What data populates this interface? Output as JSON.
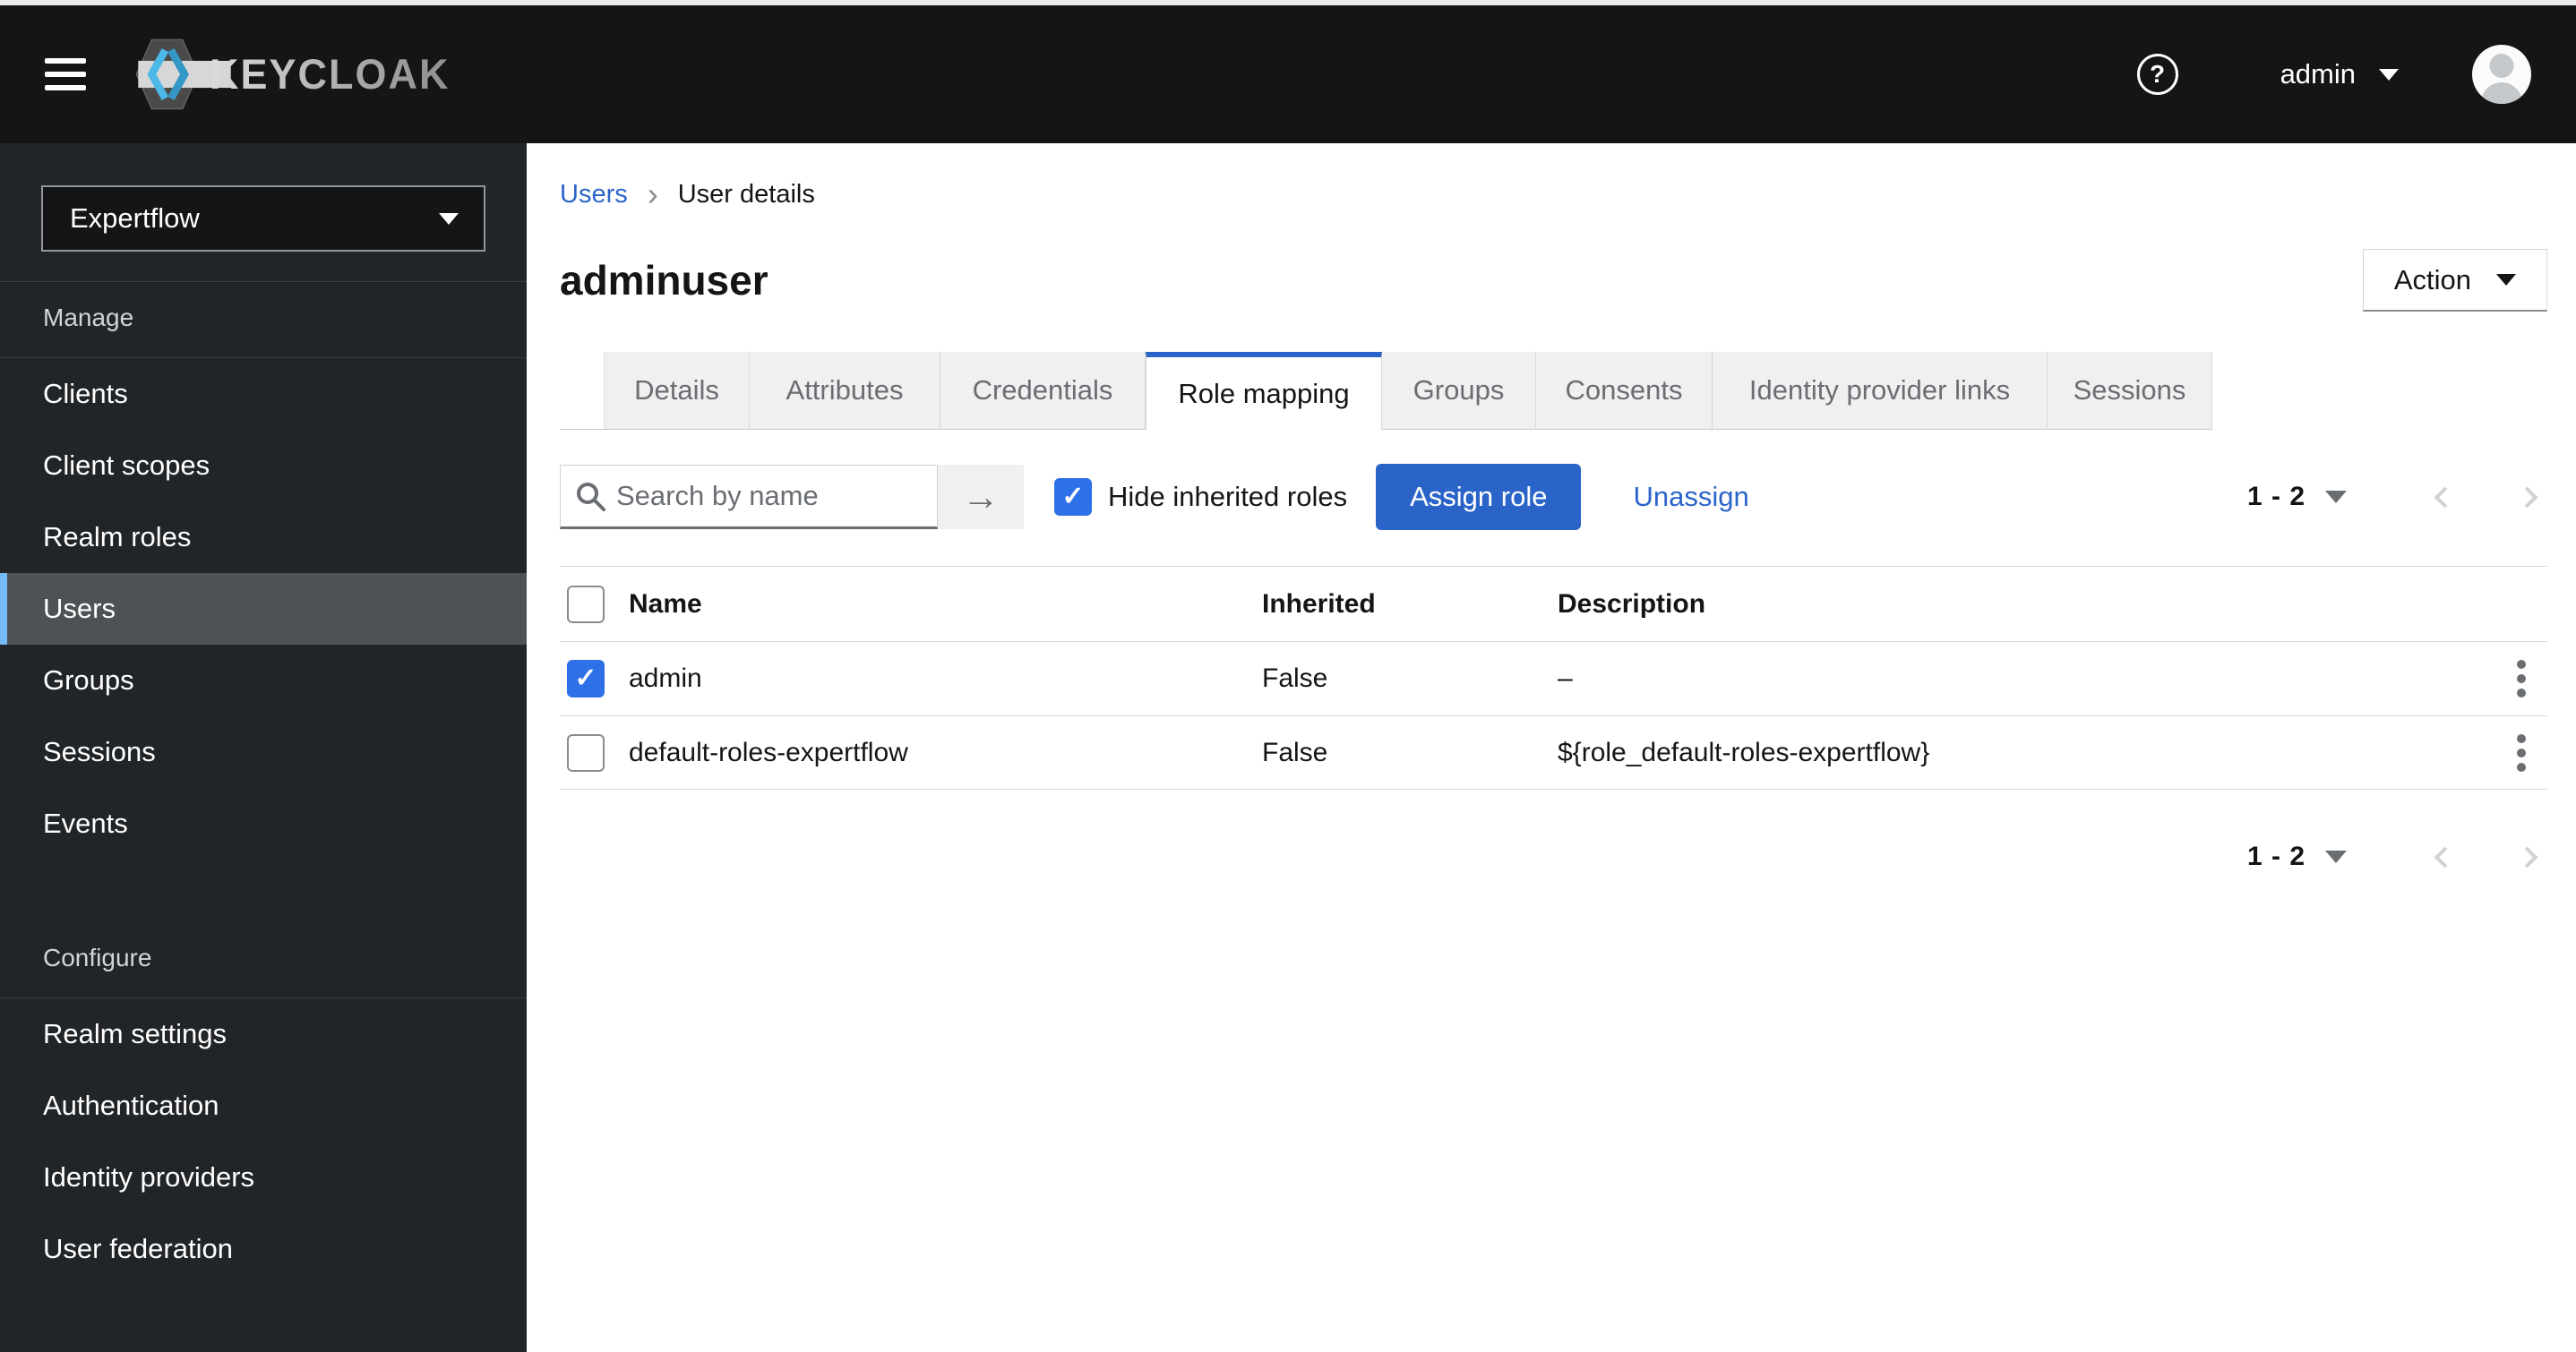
{
  "icons": {
    "check": "✓",
    "arrow_right": "→",
    "breadcrumb_sep": "›",
    "help": "?"
  },
  "header": {
    "brand": "KEYCLOAK",
    "username": "admin"
  },
  "sidebar": {
    "realm_selector": {
      "value": "Expertflow"
    },
    "sections": [
      {
        "title": "Manage",
        "items": [
          {
            "label": "Clients",
            "selected": false
          },
          {
            "label": "Client scopes",
            "selected": false
          },
          {
            "label": "Realm roles",
            "selected": false
          },
          {
            "label": "Users",
            "selected": true
          },
          {
            "label": "Groups",
            "selected": false
          },
          {
            "label": "Sessions",
            "selected": false
          },
          {
            "label": "Events",
            "selected": false
          }
        ]
      },
      {
        "title": "Configure",
        "items": [
          {
            "label": "Realm settings",
            "selected": false
          },
          {
            "label": "Authentication",
            "selected": false
          },
          {
            "label": "Identity providers",
            "selected": false
          },
          {
            "label": "User federation",
            "selected": false
          }
        ]
      }
    ]
  },
  "breadcrumb": {
    "items": [
      {
        "label": "Users"
      },
      {
        "label": "User details"
      }
    ]
  },
  "page": {
    "title": "adminuser",
    "action_label": "Action"
  },
  "tabs": [
    {
      "label": "Details",
      "active": false
    },
    {
      "label": "Attributes",
      "active": false
    },
    {
      "label": "Credentials",
      "active": false
    },
    {
      "label": "Role mapping",
      "active": true
    },
    {
      "label": "Groups",
      "active": false
    },
    {
      "label": "Consents",
      "active": false
    },
    {
      "label": "Identity provider links",
      "active": false
    },
    {
      "label": "Sessions",
      "active": false
    }
  ],
  "toolbar": {
    "search_placeholder": "Search by name",
    "hide_inherited": {
      "label": "Hide inherited roles",
      "checked": true
    },
    "assign_label": "Assign role",
    "unassign_label": "Unassign",
    "pagination": {
      "range": "1 - 2"
    }
  },
  "table": {
    "columns": [
      "Name",
      "Inherited",
      "Description"
    ],
    "rows": [
      {
        "checked": true,
        "name": "admin",
        "inherited": "False",
        "description": "–"
      },
      {
        "checked": false,
        "name": "default-roles-expertflow",
        "inherited": "False",
        "description": "${role_default-roles-expertflow}"
      }
    ]
  },
  "pagination_bottom": {
    "range": "1 - 2"
  },
  "colors": {
    "header_bg": "#151515",
    "sidebar_bg": "#222528",
    "sidebar_selected_bg": "#4f5255",
    "nav_accent": "#73bcf7",
    "primary_blue": "#2b64c9",
    "checkbox_blue": "#2e70e8",
    "link_blue": "#2b64c9",
    "tab_inactive_bg": "#f0f0f0",
    "muted_text": "#6a6e73",
    "border": "#d2d2d2"
  }
}
